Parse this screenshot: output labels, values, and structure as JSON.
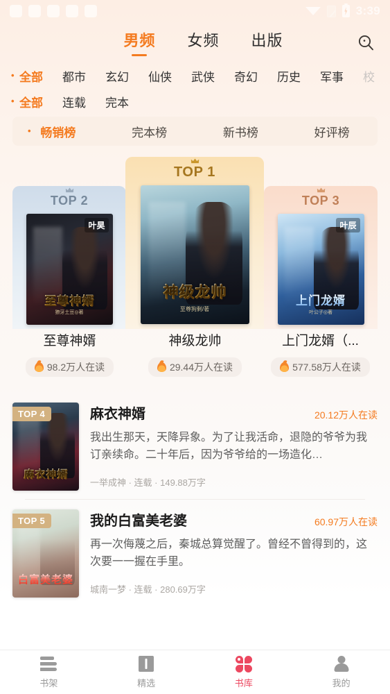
{
  "status_bar": {
    "notification_count": 5,
    "time": "3:39",
    "icons": [
      "wifi-icon",
      "signal-off-icon",
      "battery-charging-icon"
    ]
  },
  "header": {
    "tabs": [
      {
        "label": "男频",
        "active": true
      },
      {
        "label": "女频",
        "active": false
      },
      {
        "label": "出版",
        "active": false
      }
    ],
    "search_icon": "search-icon"
  },
  "filters": {
    "genre_row": [
      {
        "label": "全部",
        "active": true,
        "faded": false
      },
      {
        "label": "都市",
        "active": false,
        "faded": false
      },
      {
        "label": "玄幻",
        "active": false,
        "faded": false
      },
      {
        "label": "仙侠",
        "active": false,
        "faded": false
      },
      {
        "label": "武侠",
        "active": false,
        "faded": false
      },
      {
        "label": "奇幻",
        "active": false,
        "faded": false
      },
      {
        "label": "历史",
        "active": false,
        "faded": false
      },
      {
        "label": "军事",
        "active": false,
        "faded": false
      },
      {
        "label": "校",
        "active": false,
        "faded": true
      }
    ],
    "status_row": [
      {
        "label": "全部",
        "active": true
      },
      {
        "label": "连载",
        "active": false
      },
      {
        "label": "完本",
        "active": false
      }
    ]
  },
  "rank_tabs": [
    {
      "label": "畅销榜",
      "active": true
    },
    {
      "label": "完本榜",
      "active": false
    },
    {
      "label": "新书榜",
      "active": false
    },
    {
      "label": "好评榜",
      "active": false
    }
  ],
  "podium": [
    {
      "rank_label": "TOP 2",
      "title": "至尊神婿",
      "hot": "98.2万人在读",
      "cover_title": "至尊神婿",
      "cover_author": "獠牙土豆◎著",
      "cover_tag": "叶昊"
    },
    {
      "rank_label": "TOP 1",
      "title": "神级龙帅",
      "hot": "29.44万人在读",
      "cover_title": "神级龙帅",
      "cover_author": "至尊狗剩/著",
      "cover_tag": ""
    },
    {
      "rank_label": "TOP 3",
      "title": "上门龙婿（...",
      "hot": "577.58万人在读",
      "cover_title": "上门龙婿",
      "cover_author": "叶公子◎著",
      "cover_tag": "叶辰"
    }
  ],
  "list": [
    {
      "rank_label": "TOP 4",
      "title": "麻衣神婿",
      "hot": "20.12万人在读",
      "desc": "我出生那天，天降异象。为了让我活命，退隐的爷爷为我订亲续命。二十年后，因为爷爷给的一场造化…",
      "meta": "一举成神 · 连载 · 149.88万字",
      "cover_title": "麻衣神婿"
    },
    {
      "rank_label": "TOP 5",
      "title": "我的白富美老婆",
      "hot": "60.97万人在读",
      "desc": "再一次侮蔑之后，秦城总算觉醒了。曾经不曾得到的，这次要一一握在手里。",
      "meta": "城南一梦 · 连载 · 280.69万字",
      "cover_title": "白富美老婆"
    }
  ],
  "bottom_nav": [
    {
      "label": "书架",
      "icon": "bookshelf-icon",
      "active": false
    },
    {
      "label": "精选",
      "icon": "book-icon",
      "active": false
    },
    {
      "label": "书库",
      "icon": "clover-icon",
      "active": true
    },
    {
      "label": "我的",
      "icon": "user-icon",
      "active": false
    }
  ],
  "colors": {
    "accent_orange": "#f47b20",
    "accent_pink": "#ec4860",
    "page_bg": "#fdf3ed",
    "rank_badge": "#d3b281"
  }
}
